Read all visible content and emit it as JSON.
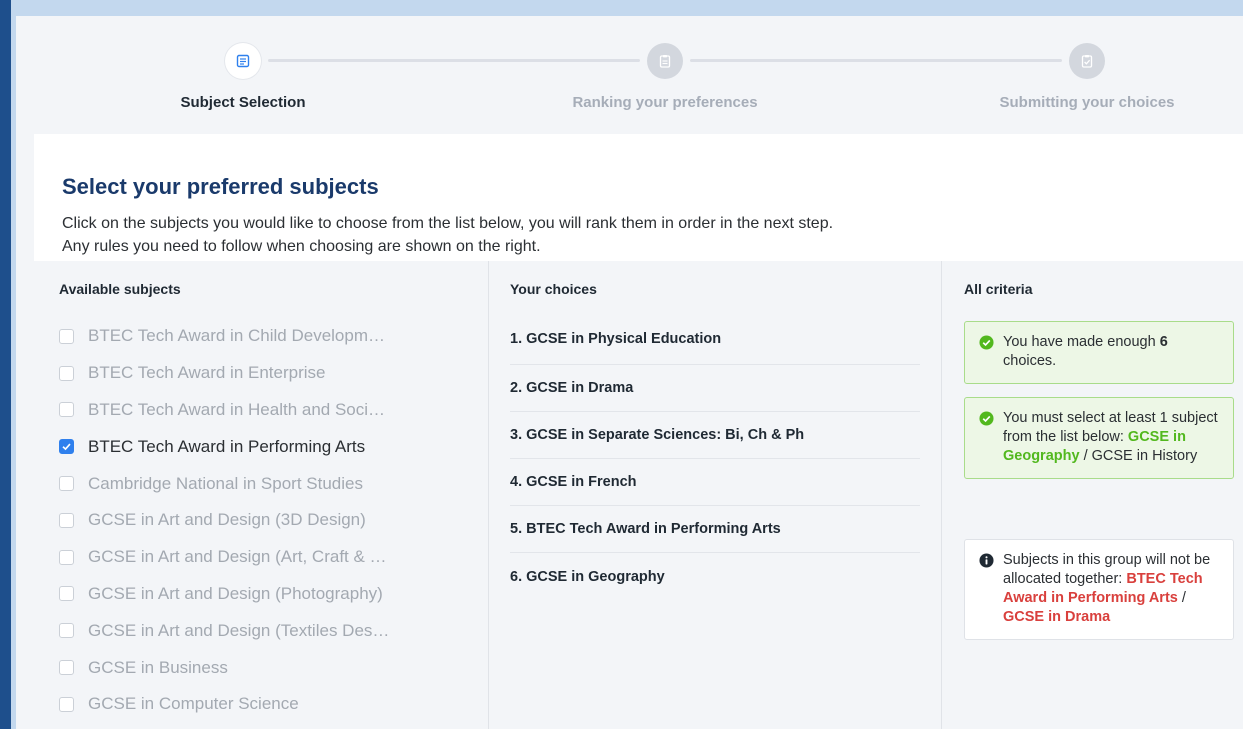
{
  "stepper": {
    "steps": [
      {
        "label": "Subject Selection",
        "state": "active",
        "icon": "list-icon"
      },
      {
        "label": "Ranking your preferences",
        "state": "inactive",
        "icon": "clipboard-icon"
      },
      {
        "label": "Submitting your choices",
        "state": "inactive",
        "icon": "clipboard-check-icon"
      }
    ]
  },
  "card": {
    "title": "Select your preferred subjects",
    "description": [
      "Click on the subjects you would like to choose from the list below, you will rank them in order in the next step.",
      "Any rules you need to follow when choosing are shown on the right."
    ]
  },
  "available": {
    "heading": "Available subjects",
    "items": [
      {
        "label": "BTEC Tech Award in Child Developm…",
        "checked": false
      },
      {
        "label": "BTEC Tech Award in Enterprise",
        "checked": false
      },
      {
        "label": "BTEC Tech Award in Health and Soci…",
        "checked": false
      },
      {
        "label": "BTEC Tech Award in Performing Arts",
        "checked": true
      },
      {
        "label": "Cambridge National in Sport Studies",
        "checked": false
      },
      {
        "label": "GCSE in Art and Design (3D Design)",
        "checked": false
      },
      {
        "label": "GCSE in Art and Design (Art, Craft & …",
        "checked": false
      },
      {
        "label": "GCSE in Art and Design (Photography)",
        "checked": false
      },
      {
        "label": "GCSE in Art and Design (Textiles Des…",
        "checked": false
      },
      {
        "label": "GCSE in Business",
        "checked": false
      },
      {
        "label": "GCSE in Computer Science",
        "checked": false
      }
    ]
  },
  "choices": {
    "heading": "Your choices",
    "items": [
      "1. GCSE in Physical Education",
      "2. GCSE in Drama",
      "3. GCSE in Separate Sciences: Bi, Ch & Ph",
      "4. GCSE in French",
      "5. BTEC Tech Award in Performing Arts",
      "6. GCSE in Geography"
    ]
  },
  "criteria": {
    "heading": "All criteria",
    "enough": {
      "text_before": "You have made enough ",
      "count": "6",
      "text_after": " choices."
    },
    "atleast": {
      "text": "You must select at least 1 subject from the list below: ",
      "option_selected": "GCSE in Geography",
      "separator": " / ",
      "option_other": "GCSE in History"
    },
    "group": {
      "text": "Subjects in this group will not be allocated together: ",
      "option_a": "BTEC Tech Award in Performing Arts",
      "separator": " / ",
      "option_b": "GCSE in Drama"
    }
  },
  "colors": {
    "title": "#1a3a6b",
    "check_blue": "#2f80ed",
    "success_green": "#52b81e",
    "conflict_red": "#d9403d"
  }
}
